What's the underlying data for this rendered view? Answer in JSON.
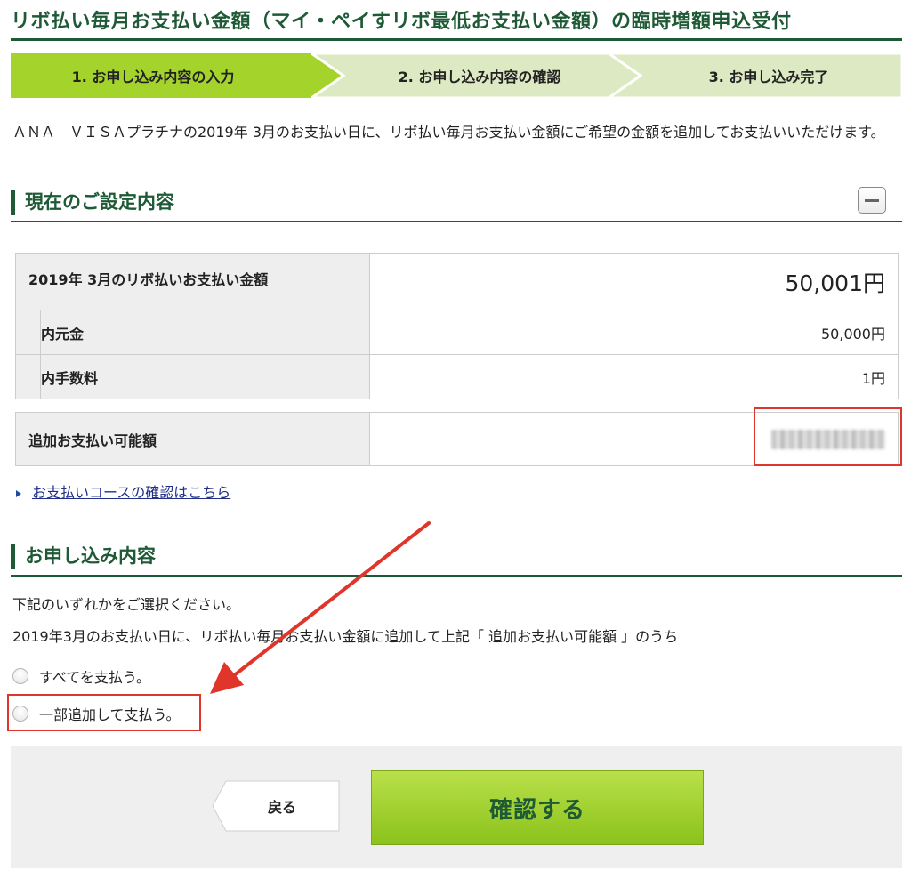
{
  "page": {
    "title": "リボ払い毎月お支払い金額（マイ・ペイすリボ最低お支払い金額）の臨時増額申込受付"
  },
  "steps": [
    {
      "label": "1. お申し込み内容の入力"
    },
    {
      "label": "2. お申し込み内容の確認"
    },
    {
      "label": "3. お申し込み完了"
    }
  ],
  "intro": "ＡＮＡ　ＶＩＳＡプラチナの2019年 3月のお支払い日に、リボ払い毎月お支払い金額にご希望の金額を追加してお支払いいただけます。",
  "current_settings": {
    "heading": "現在のご設定内容",
    "collapse_icon": "minus-icon",
    "total_label": "2019年 3月のリボ払いお支払い金額",
    "total_value": "50,001円",
    "principal_label": "内元金",
    "principal_value": "50,000円",
    "fee_label": "内手数料",
    "fee_value": "1円",
    "additional_label": "追加お支払い可能額"
  },
  "course_link": "お支払いコースの確認はこちら",
  "application": {
    "heading": "お申し込み内容",
    "instruction": "下記のいずれかをご選択ください。",
    "description": "2019年3月のお支払い日に、リボ払い毎月お支払い金額に追加して上記「 追加お支払い可能額 」のうち",
    "options": [
      {
        "label": "すべてを支払う。"
      },
      {
        "label": "一部追加して支払う。"
      }
    ]
  },
  "buttons": {
    "back": "戻る",
    "confirm": "確認する"
  },
  "colors": {
    "brand_green": "#1f5a36",
    "active_step": "#a4d32c",
    "inactive_step": "#dde9c2",
    "annotation_red": "#e0352b"
  }
}
